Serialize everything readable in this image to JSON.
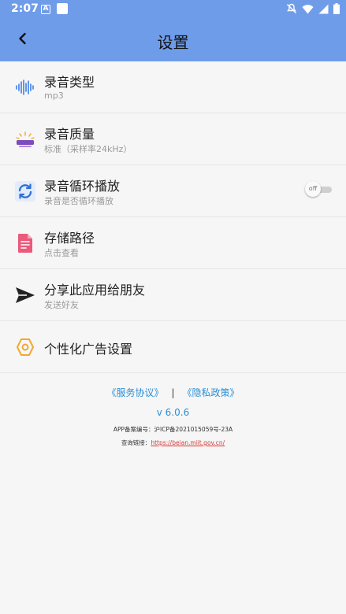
{
  "status_bar": {
    "time": "2:07",
    "notif_a": "A"
  },
  "header": {
    "title": "设置",
    "accent_color": "#6f9ce9"
  },
  "settings": [
    {
      "title": "录音类型",
      "subtitle": "mp3",
      "icon": "waveform-icon",
      "icon_color": "#3f7fe6"
    },
    {
      "title": "录音质量",
      "subtitle": "标准（采样率24kHz）",
      "icon": "quality-icon",
      "icon_color": "#7c4dbd"
    },
    {
      "title": "录音循环播放",
      "subtitle": "录音是否循环播放",
      "icon": "loop-icon",
      "icon_color": "#2f6fd3",
      "toggle": {
        "label": "off",
        "on": false
      }
    },
    {
      "title": "存储路径",
      "subtitle": "点击查看",
      "icon": "document-icon",
      "icon_color": "#ea5a7a"
    },
    {
      "title": "分享此应用给朋友",
      "subtitle": "发送好友",
      "icon": "send-icon",
      "icon_color": "#222222"
    },
    {
      "title": "个性化广告设置",
      "icon": "ad-settings-icon",
      "icon_color": "#f0a830"
    }
  ],
  "footer": {
    "service_agreement": "《服务协议》",
    "separator": "|",
    "privacy_policy": "《隐私政策》",
    "version": "v 6.0.6",
    "icp_label": "APP备案编号：沪ICP备2021015059号-23A",
    "query_label": "查询链接：",
    "query_link": "https://beian.miit.gov.cn/"
  }
}
